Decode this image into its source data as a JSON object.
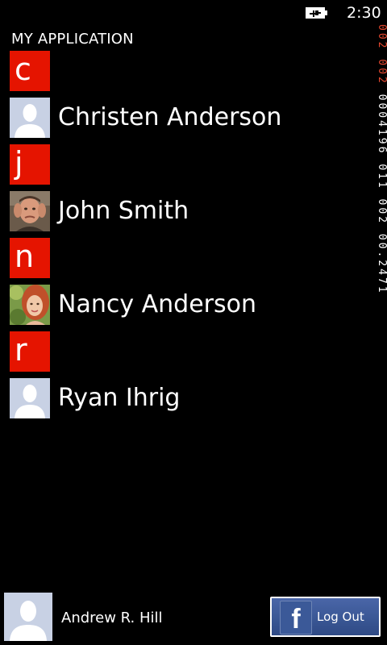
{
  "status_bar": {
    "time": "2:30",
    "battery_icon": "battery-charging-icon"
  },
  "app": {
    "title": "MY APPLICATION"
  },
  "contacts": [
    {
      "letter": "c",
      "name": "Christen Anderson",
      "avatar": "placeholder"
    },
    {
      "letter": "j",
      "name": "John Smith",
      "avatar": "photo-man"
    },
    {
      "letter": "n",
      "name": "Nancy Anderson",
      "avatar": "photo-woman"
    },
    {
      "letter": "r",
      "name": "Ryan Ihrig",
      "avatar": "placeholder"
    }
  ],
  "debug_counter": {
    "red_part": "002 002",
    "white_part": "0004196 011 002 00.2471"
  },
  "footer": {
    "user_name": "Andrew R. Hill",
    "facebook_logo": "f",
    "logout_label": "Log Out"
  },
  "colors": {
    "accent": "#e51400",
    "background": "#000000",
    "facebook_blue": "#3b5998"
  }
}
